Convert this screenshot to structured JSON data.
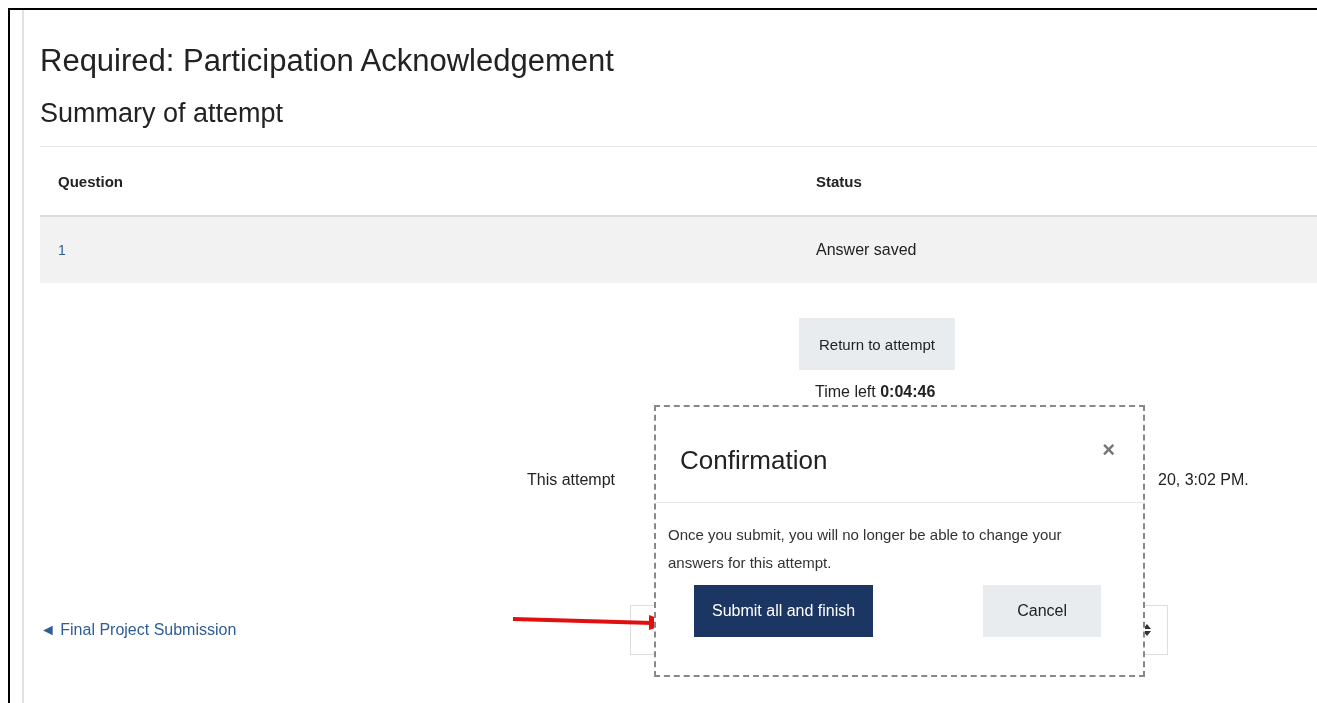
{
  "page": {
    "title": "Required: Participation Acknowledgement",
    "subtitle": "Summary of attempt"
  },
  "table": {
    "columns": [
      "Question",
      "Status"
    ],
    "rows": [
      {
        "question": "1",
        "status": "Answer saved"
      }
    ]
  },
  "return_button": "Return to attempt",
  "time_left": "Time left **0:04:46**",
  "attempt_note": {
    "start": "This attempt",
    "end": "20, 3:02 PM."
  },
  "nav_link": {
    "icon": "◄",
    "label": "Final Project Submission"
  },
  "dialog": {
    "title": "Confirmation",
    "close": "×",
    "message": "Once you submit, you will no longer be able to change your answers for this attempt.",
    "buttons": [
      {
        "label": "Submit all and finish",
        "kind": "primary"
      },
      {
        "label": "Cancel",
        "kind": "secondary"
      }
    ]
  }
}
